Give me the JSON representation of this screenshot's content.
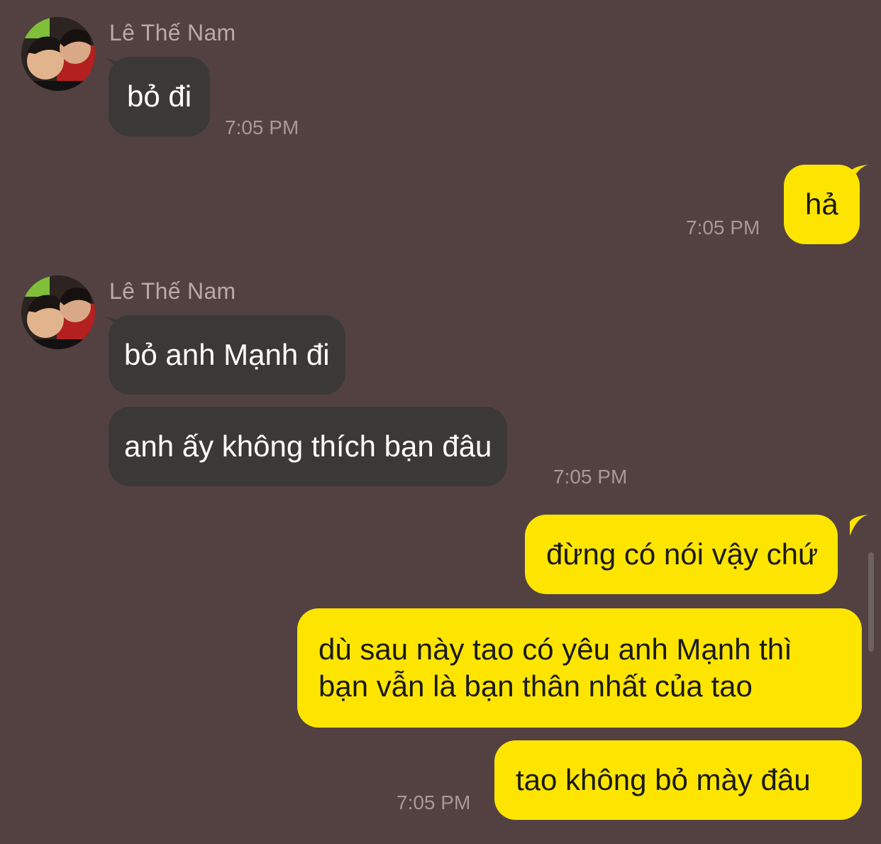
{
  "conversation": {
    "messages": [
      {
        "sender": "Lê Thế Nam",
        "text": "bỏ đi",
        "time": "7:05 PM"
      },
      {
        "text": "hả",
        "time": "7:05 PM"
      },
      {
        "sender": "Lê Thế Nam",
        "text": "bỏ anh Mạnh đi"
      },
      {
        "text": "anh ấy không thích bạn đâu",
        "time": "7:05 PM"
      },
      {
        "text": "đừng có nói vậy chứ"
      },
      {
        "line1": "dù sau này tao có yêu anh Mạnh thì",
        "line2": "bạn vẫn là bạn thân nhất của tao"
      },
      {
        "text": "tao không bỏ mày đâu",
        "time": "7:05 PM"
      }
    ]
  },
  "colors": {
    "background": "#534142",
    "incoming_bubble": "#3b3838",
    "outgoing_bubble": "#fee500"
  }
}
